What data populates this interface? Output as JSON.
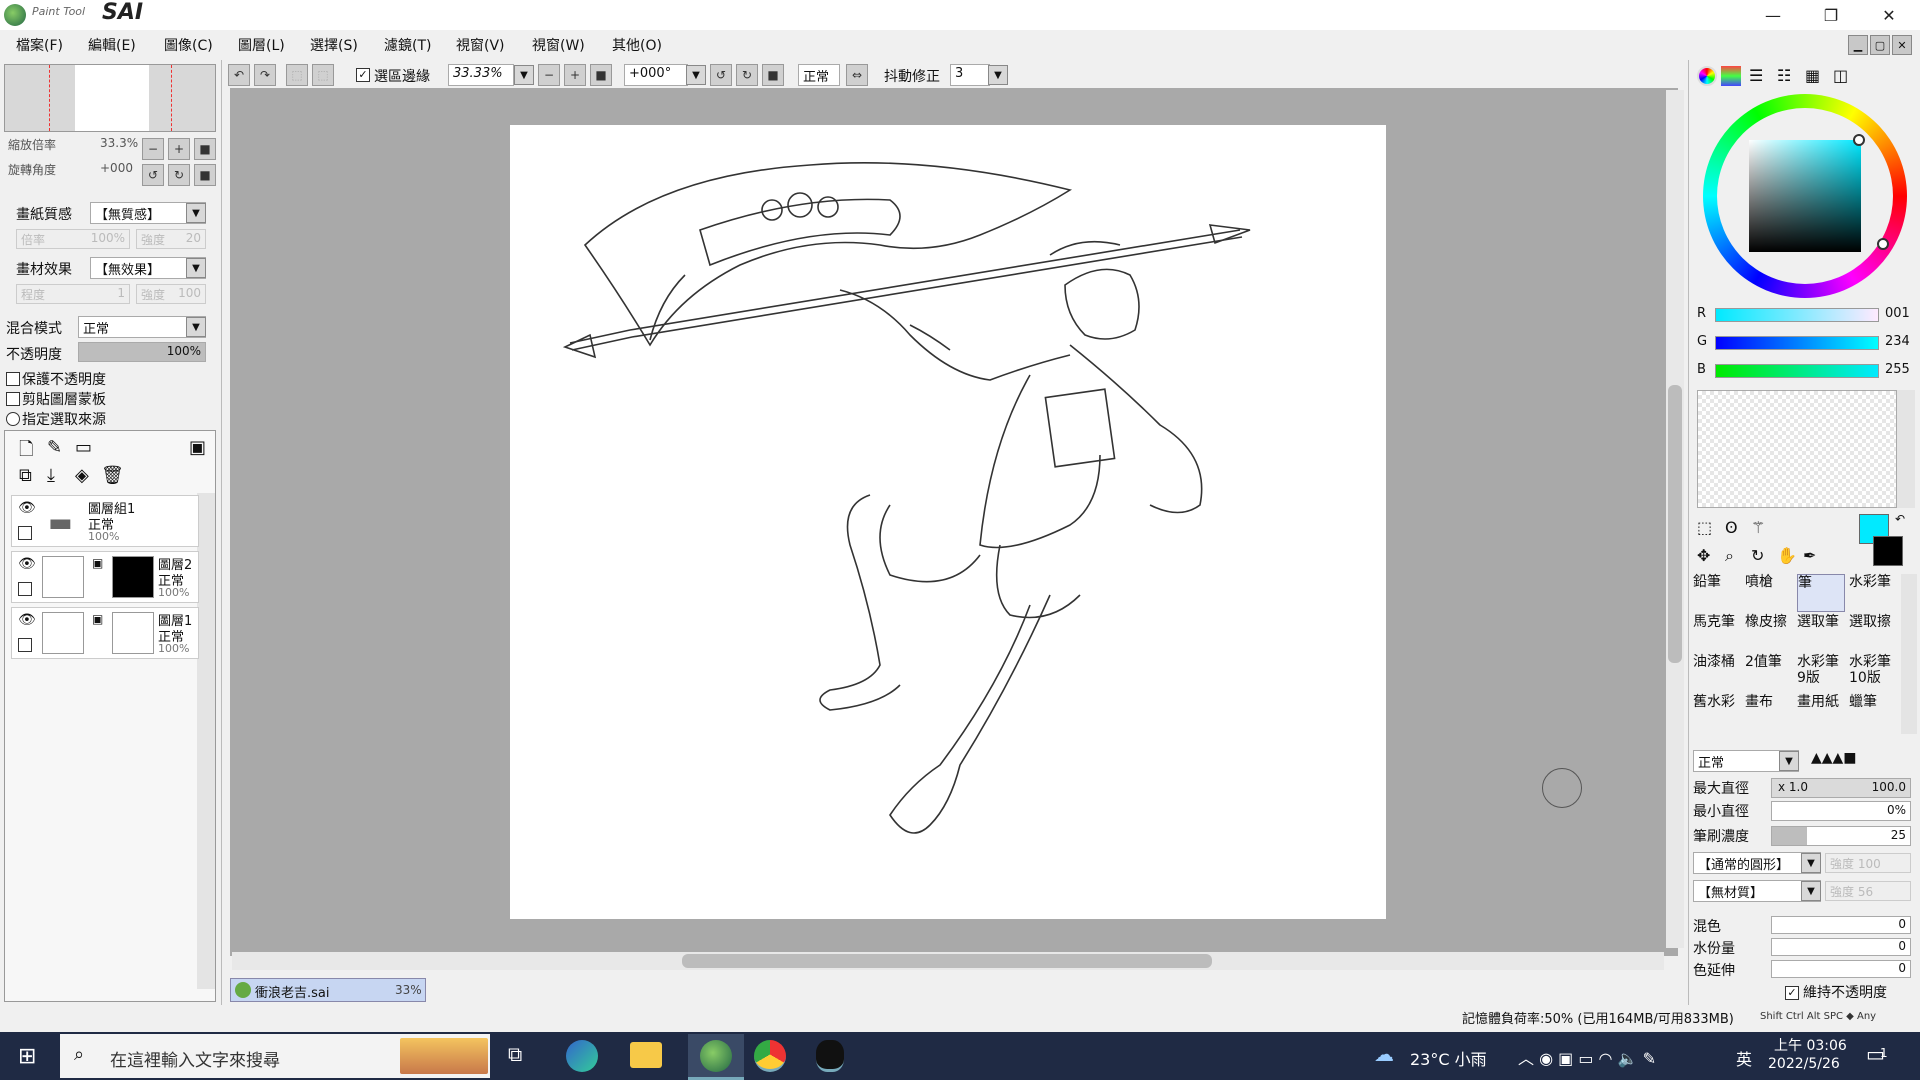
{
  "app": {
    "title": "PaintTool SAI",
    "logo_small": "Paint Tool",
    "logo_big": "SAI"
  },
  "menu": [
    "檔案(F)",
    "編輯(E)",
    "圖像(C)",
    "圖層(L)",
    "選擇(S)",
    "濾鏡(T)",
    "視窗(V)",
    "視窗(W)",
    "其他(O)"
  ],
  "toolbar": {
    "select_edge_label": "選區邊緣",
    "zoom": "33.33%",
    "rotation": "+000°",
    "mode": "正常",
    "stabilizer_label": "抖動修正",
    "stabilizer_value": "3"
  },
  "navigator": {
    "zoom_label": "縮放倍率",
    "zoom_value": "33.3%",
    "angle_label": "旋轉角度",
    "angle_value": "+000"
  },
  "paper": {
    "texture_label": "畫紙質感",
    "texture_value": "【無質感】",
    "scale_label": "倍率",
    "scale_value": "100%",
    "strength_label": "強度",
    "strength_value": "20",
    "effect_label": "畫材效果",
    "effect_value": "【無效果】",
    "degree_label": "程度",
    "degree_value": "1",
    "effect_strength_label": "強度",
    "effect_strength_value": "100"
  },
  "blend": {
    "mode_label": "混合模式",
    "mode_value": "正常",
    "opacity_label": "不透明度",
    "opacity_value": "100%",
    "opacity_fraction": 1.0
  },
  "layer_options": [
    "保護不透明度",
    "剪貼圖層蒙板",
    "指定選取來源"
  ],
  "layers": [
    {
      "name": "圖層組1",
      "mode": "正常",
      "opacity": "100%"
    },
    {
      "name": "圖層2",
      "mode": "正常",
      "opacity": "100%"
    },
    {
      "name": "圖層1",
      "mode": "正常",
      "opacity": "100%"
    }
  ],
  "document_tab": {
    "name": "衝浪老吉.sai",
    "zoom": "33%"
  },
  "color": {
    "r_label": "R",
    "r_value": "001",
    "g_label": "G",
    "g_value": "234",
    "b_label": "B",
    "b_value": "255",
    "current": "#01eaff",
    "secondary": "#000000"
  },
  "brushes": [
    [
      "鉛筆",
      "噴槍",
      "筆",
      "水彩筆"
    ],
    [
      "馬克筆",
      "橡皮擦",
      "選取筆",
      "選取擦"
    ],
    [
      "油漆桶",
      "2值筆",
      "水彩筆9版",
      "水彩筆10版"
    ],
    [
      "舊水彩",
      "畫布",
      "畫用紙",
      "蠟筆"
    ]
  ],
  "brush_settings": {
    "mode": "正常",
    "max_size_label": "最大直徑",
    "max_size_mult": "x 1.0",
    "max_size_value": "100.0",
    "min_size_label": "最小直徑",
    "min_size_value": "0%",
    "density_label": "筆刷濃度",
    "density_value": "25",
    "shape": "【通常的圓形】",
    "shape_strength": "強度 100",
    "texture": "【無材質】",
    "texture_strength": "強度 56",
    "blend_label": "混色",
    "blend_value": "0",
    "water_label": "水份量",
    "water_value": "0",
    "persist_label": "色延伸",
    "persist_value": "0",
    "keep_opacity_label": "維持不透明度"
  },
  "status": {
    "memory": "記憶體負荷率:50% (已用164MB/可用833MB)",
    "keys": "Shift Ctrl Alt SPC ◆ Any"
  },
  "taskbar": {
    "search_placeholder": "在這裡輸入文字來搜尋",
    "weather": "23°C 小雨",
    "ime": "英",
    "time": "上午 03:06",
    "date": "2022/5/26",
    "notif": "1"
  }
}
